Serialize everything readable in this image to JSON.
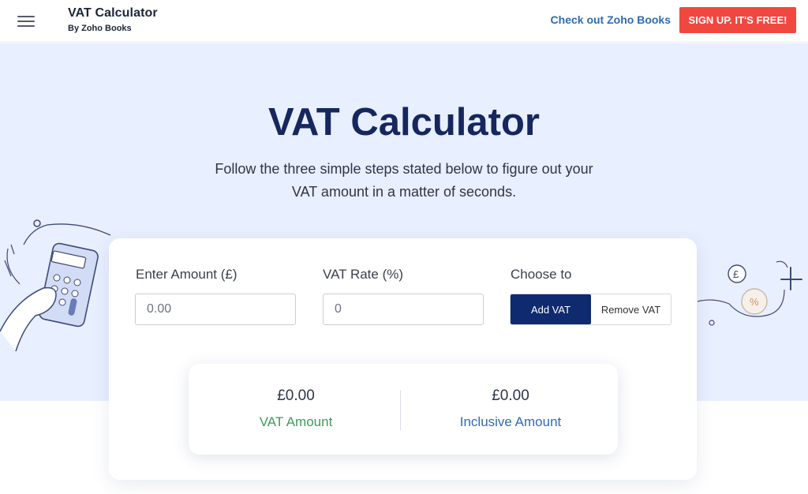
{
  "header": {
    "title": "VAT Calculator",
    "subtitle": "By Zoho Books",
    "link_label": "Check out Zoho Books",
    "signup_label": "SIGN UP. IT'S FREE!"
  },
  "hero": {
    "title": "VAT Calculator",
    "subtitle": "Follow the three simple steps stated below to figure out your VAT amount in a matter of seconds."
  },
  "form": {
    "amount_label": "Enter Amount (£)",
    "amount_placeholder": "0.00",
    "rate_label": "VAT Rate (%)",
    "rate_placeholder": "0",
    "choose_label": "Choose to",
    "add_label": "Add VAT",
    "remove_label": "Remove VAT",
    "selected": "Add VAT"
  },
  "results": {
    "vat_value": "£0.00",
    "vat_label": "VAT Amount",
    "inclusive_value": "£0.00",
    "inclusive_label": "Inclusive Amount"
  },
  "colors": {
    "accent": "#0f2a6e",
    "signup": "#f0483e",
    "link": "#2e6bb3",
    "vat_label": "#3d9a5a",
    "inclusive_label": "#2e6bb3",
    "hero_bg": "#e8efff"
  },
  "icons": {
    "menu": "hamburger-menu-icon",
    "deco_left": "calculator-illustration",
    "deco_right": "currency-illustration"
  }
}
